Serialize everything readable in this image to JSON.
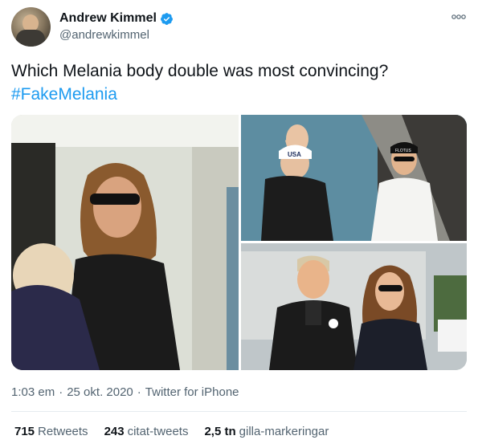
{
  "author": {
    "name": "Andrew Kimmel",
    "handle": "@andrewkimmel",
    "verified": true
  },
  "tweet": {
    "text": "Which Melania body double was most convincing?",
    "hashtag": "#FakeMelania"
  },
  "media": {
    "photo_count": 3,
    "photo_1_cap_text": "USA",
    "photo_2_cap_text": "FLOTUS"
  },
  "meta": {
    "time": "1:03 em",
    "separator": "·",
    "date": "25 okt. 2020",
    "source": "Twitter for iPhone"
  },
  "stats": {
    "retweets_count": "715",
    "retweets_label": "Retweets",
    "quotes_count": "243",
    "quotes_label": "citat-tweets",
    "likes_count": "2,5 tn",
    "likes_label": "gilla-markeringar"
  },
  "colors": {
    "accent": "#1d9bf0",
    "text": "#0f1419",
    "secondary": "#536471"
  },
  "icons": [
    "verified-icon",
    "more-icon"
  ]
}
